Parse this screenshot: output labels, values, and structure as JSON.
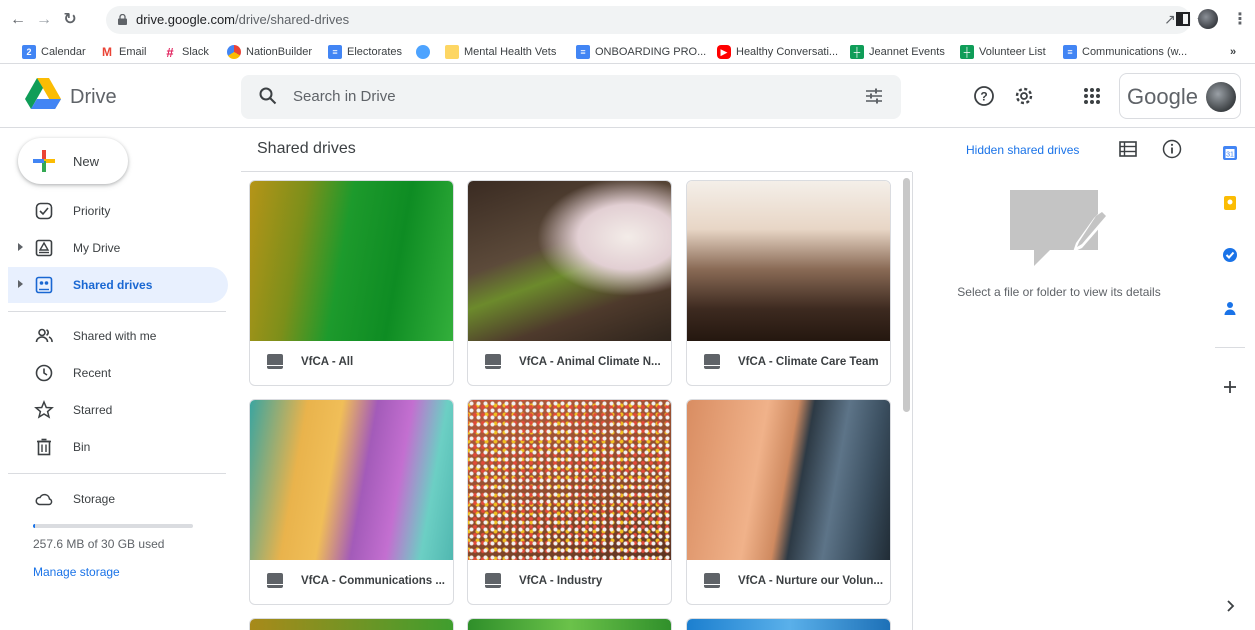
{
  "browser": {
    "url_host": "drive.google.com",
    "url_path": "/drive/shared-drives",
    "bookmarks": [
      {
        "label": "Calendar",
        "icon": "calendar-icon",
        "color": "#4285f4"
      },
      {
        "label": "Email",
        "icon": "gmail-icon",
        "color": "#ea4335"
      },
      {
        "label": "Slack",
        "icon": "slack-icon",
        "color": "#e01e5a"
      },
      {
        "label": "NationBuilder",
        "icon": "nationbuilder-icon",
        "color": "#fbbc04"
      },
      {
        "label": "Electorates",
        "icon": "docs-icon",
        "color": "#4285f4"
      },
      {
        "label": "",
        "icon": "globe-icon",
        "color": "#4da3ff"
      },
      {
        "label": "Mental Health Vets",
        "icon": "folder-icon",
        "color": "#fdd663"
      },
      {
        "label": "ONBOARDING PRO...",
        "icon": "docs-icon",
        "color": "#4285f4"
      },
      {
        "label": "Healthy Conversati...",
        "icon": "youtube-icon",
        "color": "#ff0000"
      },
      {
        "label": "Jeannet Events",
        "icon": "sheets-icon",
        "color": "#0f9d58"
      },
      {
        "label": "Volunteer List",
        "icon": "sheets-icon",
        "color": "#0f9d58"
      },
      {
        "label": "Communications (w...",
        "icon": "docs-icon",
        "color": "#4285f4"
      }
    ],
    "more": "»"
  },
  "header": {
    "app_name": "Drive",
    "search_placeholder": "Search in Drive",
    "google_word": "Google"
  },
  "sidebar": {
    "new_label": "New",
    "items": [
      {
        "label": "Priority",
        "icon": "priority-icon"
      },
      {
        "label": "My Drive",
        "icon": "my-drive-icon"
      },
      {
        "label": "Shared drives",
        "icon": "shared-drives-icon",
        "active": true
      },
      {
        "label": "Shared with me",
        "icon": "shared-with-me-icon"
      },
      {
        "label": "Recent",
        "icon": "clock-icon"
      },
      {
        "label": "Starred",
        "icon": "star-icon"
      },
      {
        "label": "Bin",
        "icon": "bin-icon"
      },
      {
        "label": "Storage",
        "icon": "cloud-icon"
      }
    ],
    "storage_text": "257.6 MB of 30 GB used",
    "storage_used_fraction": 0.0084,
    "manage_storage": "Manage storage"
  },
  "main": {
    "title": "Shared drives",
    "hidden_link": "Hidden shared drives",
    "drives": [
      {
        "name": "VfCA - All"
      },
      {
        "name": "VfCA - Animal Climate N..."
      },
      {
        "name": "VfCA - Climate Care Team"
      },
      {
        "name": "VfCA - Communications ..."
      },
      {
        "name": "VfCA - Industry"
      },
      {
        "name": "VfCA - Nurture our Volun..."
      }
    ]
  },
  "details": {
    "empty_message": "Select a file or folder to view its details"
  },
  "colors": {
    "accent": "#1a73e8",
    "active_bg": "#e8f0fe"
  }
}
